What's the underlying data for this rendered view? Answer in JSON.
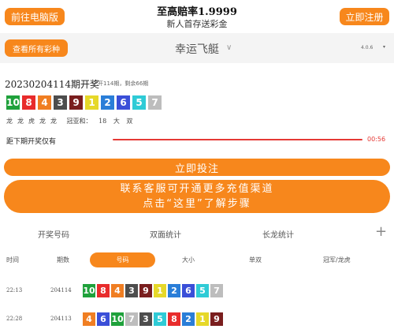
{
  "header": {
    "left_button": "前往电脑版",
    "title": "至高赔率1.9999",
    "subtitle": "新人首存送彩金",
    "right_button": "立即注册"
  },
  "selector": {
    "all_lotteries_button": "查看所有彩种",
    "game_name": "幸运飞艇",
    "small_label": "4.0.6"
  },
  "draw": {
    "issue_text": "20230204114期开奖",
    "progress_note": "已开114期，剩余66期",
    "numbers": [
      "10",
      "8",
      "4",
      "3",
      "9",
      "1",
      "2",
      "6",
      "5",
      "7"
    ],
    "dragon_tiger": [
      "龙",
      "龙",
      "虎",
      "龙",
      "龙"
    ],
    "sum_label": "冠亚和：",
    "sum_value": "18",
    "sum_size": "大",
    "sum_parity": "双"
  },
  "countdown": {
    "label": "距下期开奖仅有",
    "time": "00:56",
    "remaining_fraction": 1.0
  },
  "actions": {
    "bet_button": "立即投注",
    "service_line1": "联系客服可开通更多充值渠道",
    "service_line2": "点击“这里”了解步骤"
  },
  "tabs": [
    "开奖号码",
    "双面统计",
    "长龙统计"
  ],
  "columns": [
    "时间",
    "期数",
    "号码",
    "大小",
    "单双",
    "冠军/龙虎"
  ],
  "history": [
    {
      "time": "22:13",
      "issue": "204114",
      "numbers": [
        "10",
        "8",
        "4",
        "3",
        "9",
        "1",
        "2",
        "6",
        "5",
        "7"
      ]
    },
    {
      "time": "22:28",
      "issue": "204113",
      "numbers": [
        "4",
        "6",
        "10",
        "7",
        "3",
        "5",
        "8",
        "2",
        "1",
        "9"
      ]
    }
  ],
  "ball_colors": {
    "1": "#e6d829",
    "2": "#2a7ed8",
    "3": "#4d4d4d",
    "4": "#f07e22",
    "5": "#2fcbd6",
    "6": "#3a4fd8",
    "7": "#bdbdbd",
    "8": "#e82c2c",
    "9": "#7a1e1e",
    "10": "#1fa13b"
  },
  "accent_color": "#f7871c"
}
